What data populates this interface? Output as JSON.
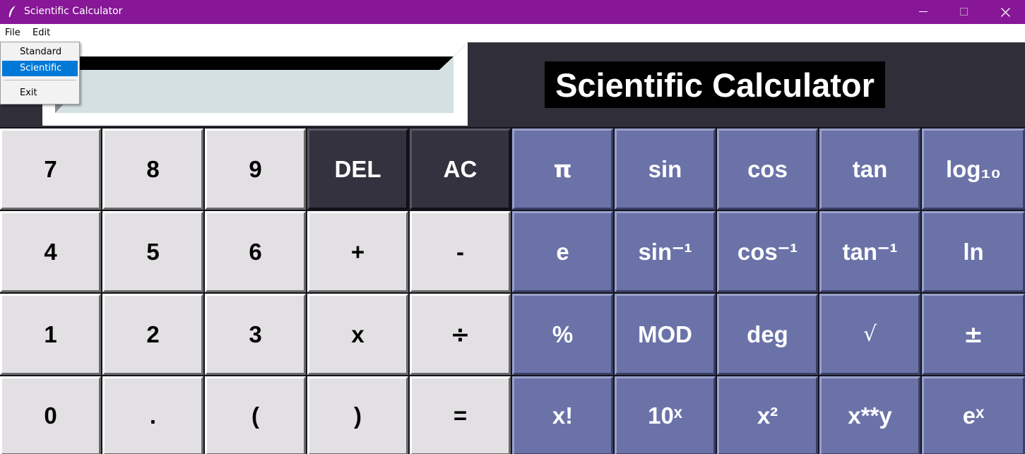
{
  "window": {
    "title": "Scientific Calculator"
  },
  "menubar": {
    "file": "File",
    "edit": "Edit"
  },
  "file_menu": {
    "items": [
      "Standard",
      "Scientific",
      "Exit"
    ],
    "selected": "Scientific"
  },
  "display": {
    "value": ""
  },
  "headline": "Scientific Calculator",
  "keys": {
    "row1": [
      "7",
      "8",
      "9",
      "DEL",
      "AC",
      "π",
      "sin",
      "cos",
      "tan",
      "log₁₀"
    ],
    "row2": [
      "4",
      "5",
      "6",
      "+",
      "-",
      "e",
      "sin⁻¹",
      "cos⁻¹",
      "tan⁻¹",
      "ln"
    ],
    "row3": [
      "1",
      "2",
      "3",
      "x",
      "÷",
      "%",
      "MOD",
      "deg",
      "√",
      "±"
    ],
    "row4": [
      "0",
      ".",
      "(",
      ")",
      "=",
      "x!",
      "10ˣ",
      "x²",
      "x**y",
      "eˣ"
    ]
  },
  "colors": {
    "titlebar": "#871796",
    "top_background": "#302e39",
    "light_key": "#e2e0e2",
    "dark_key": "#34323e",
    "function_key": "#6a72a8",
    "menu_highlight": "#0078d7"
  },
  "icons": {
    "app": "feather-icon",
    "minimize": "minimize-icon",
    "maximize": "maximize-icon",
    "close": "close-icon"
  }
}
